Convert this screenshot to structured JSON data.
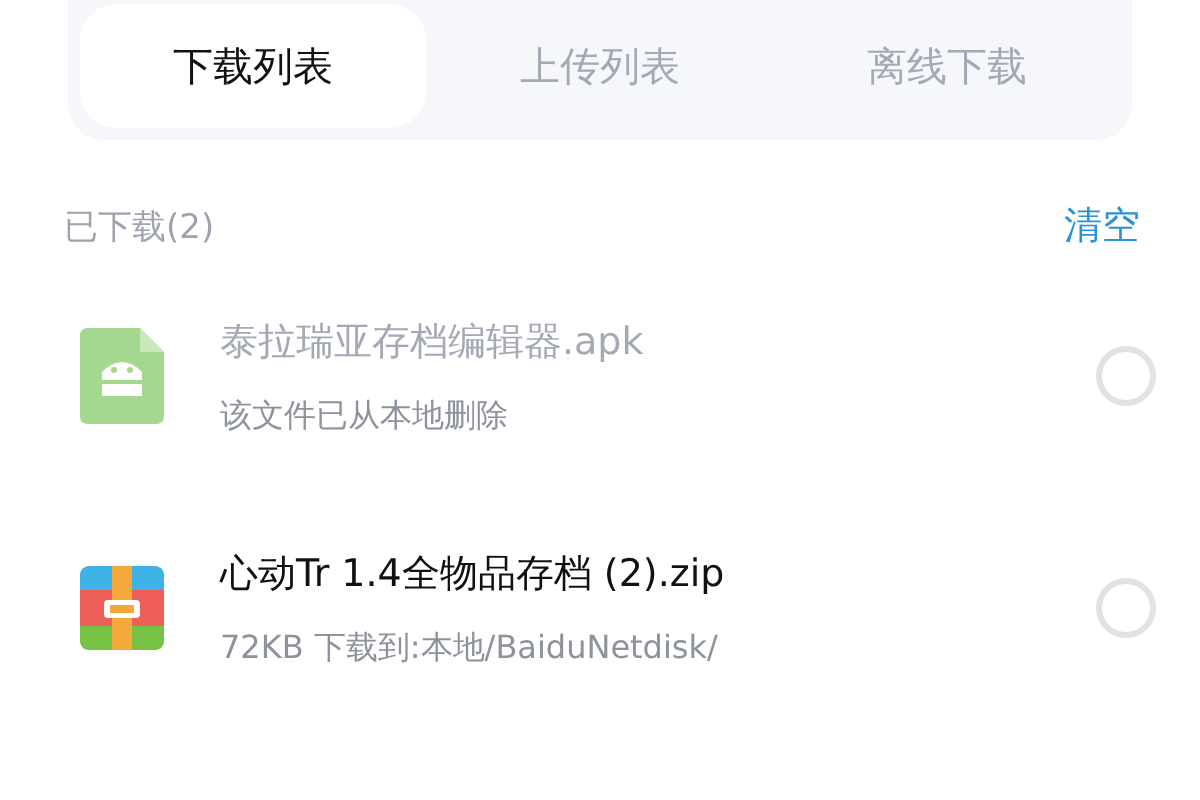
{
  "tabs": [
    {
      "label": "下载列表",
      "selected": true
    },
    {
      "label": "上传列表",
      "selected": false
    },
    {
      "label": "离线下载",
      "selected": false
    }
  ],
  "section": {
    "title": "已下载(2)",
    "action": "清空"
  },
  "files": [
    {
      "kind": "apk",
      "name": "泰拉瑞亚存档编辑器.apk",
      "detail": "该文件已从本地删除",
      "deleted": true,
      "selected": false
    },
    {
      "kind": "zip",
      "name": "心动Tr 1.4全物品存档 (2).zip",
      "detail": "72KB 下载到:本地/BaiduNetdisk/",
      "deleted": false,
      "selected": false
    }
  ]
}
